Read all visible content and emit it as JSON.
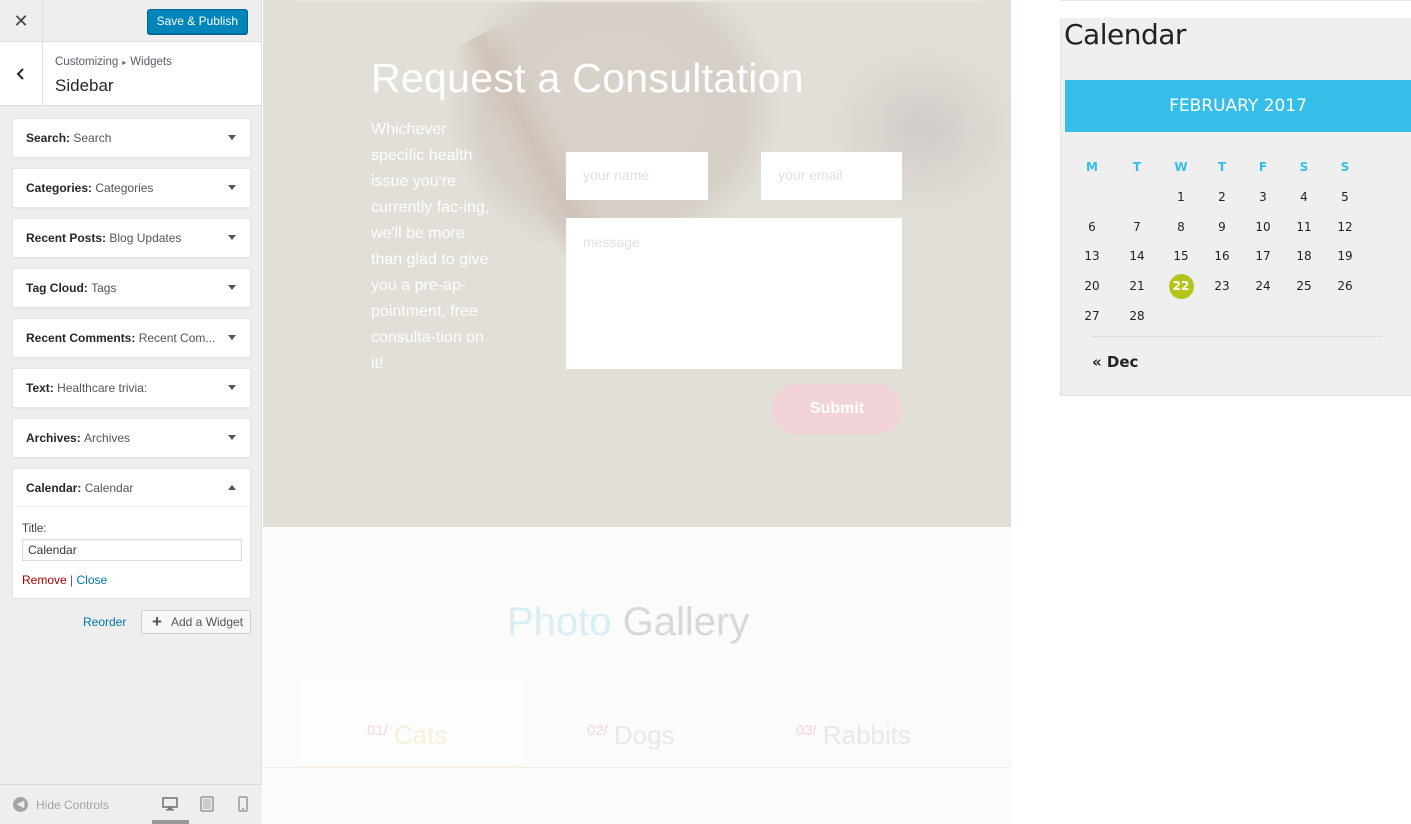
{
  "customizer": {
    "close_label": "✕",
    "publish_label": "Save & Publish",
    "breadcrumb": {
      "root": "Customizing",
      "separator": "▸",
      "section": "Widgets"
    },
    "panel_title": "Sidebar",
    "widgets": [
      {
        "type": "Search",
        "title": "Search"
      },
      {
        "type": "Categories",
        "title": "Categories"
      },
      {
        "type": "Recent Posts",
        "title": "Blog Updates"
      },
      {
        "type": "Tag Cloud",
        "title": "Tags"
      },
      {
        "type": "Recent Comments",
        "title": "Recent Com..."
      },
      {
        "type": "Text",
        "title": "Healthcare trivia:"
      },
      {
        "type": "Archives",
        "title": "Archives"
      },
      {
        "type": "Calendar",
        "title": "Calendar"
      }
    ],
    "widget_form": {
      "title_label": "Title:",
      "title_value": "Calendar",
      "remove_label": "Remove",
      "divider": "|",
      "close_label": "Close"
    },
    "reorder_label": "Reorder",
    "add_widget_label": "Add a Widget",
    "hide_controls_label": "Hide Controls"
  },
  "preview": {
    "consultation": {
      "heading": "Request a Consultation",
      "lead": "Whichever specific health issue you're currently fac-ing, we'll be more than glad to give you a pre-ap-pointment, free consulta-tion on it!",
      "name_placeholder": "your name",
      "email_placeholder": "your email",
      "message_placeholder": "message",
      "submit_label": "Submit"
    },
    "gallery": {
      "title_accent": "Photo",
      "title_rest": "Gallery",
      "tabs": [
        {
          "num": "01/",
          "label": "Cats"
        },
        {
          "num": "02/",
          "label": "Dogs"
        },
        {
          "num": "03/",
          "label": "Rabbits"
        }
      ]
    },
    "calendar": {
      "widget_title": "Calendar",
      "month": "FEBRUARY 2017",
      "weekdays": [
        "M",
        "T",
        "W",
        "T",
        "F",
        "S",
        "S"
      ],
      "weeks": [
        [
          "",
          "",
          "1",
          "2",
          "3",
          "4",
          "5"
        ],
        [
          "6",
          "7",
          "8",
          "9",
          "10",
          "11",
          "12"
        ],
        [
          "13",
          "14",
          "15",
          "16",
          "17",
          "18",
          "19"
        ],
        [
          "20",
          "21",
          "22",
          "23",
          "24",
          "25",
          "26"
        ],
        [
          "27",
          "28",
          "",
          "",
          "",
          "",
          ""
        ]
      ],
      "today": "22",
      "prev_link": "« Dec",
      "accent_color": "#35bee8",
      "today_color": "#b5c41a"
    }
  }
}
